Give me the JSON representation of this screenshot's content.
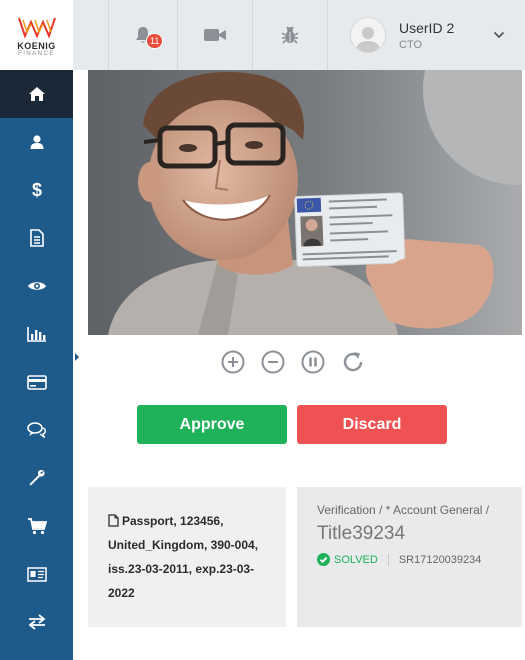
{
  "brand": {
    "name": "KOENIG",
    "sub": "FINANCE"
  },
  "sidebar": {
    "items": [
      {
        "icon": "home-icon",
        "active": true
      },
      {
        "icon": "user-icon"
      },
      {
        "icon": "dollar-icon"
      },
      {
        "icon": "document-icon"
      },
      {
        "icon": "eye-icon"
      },
      {
        "icon": "bar-chart-icon"
      },
      {
        "icon": "credit-card-icon"
      },
      {
        "icon": "chat-icon"
      },
      {
        "icon": "wrench-icon"
      },
      {
        "icon": "cart-icon"
      },
      {
        "icon": "id-card-icon"
      },
      {
        "icon": "exchange-icon"
      }
    ]
  },
  "header": {
    "notifications_count": "11",
    "user": {
      "name": "UserID 2",
      "role": "CTO"
    }
  },
  "actions": {
    "approve_label": "Approve",
    "discard_label": "Discard"
  },
  "document": {
    "text": "Passport, 123456, United_Kingdom, 390-004, iss.23-03-2011, exp.23-03-2022"
  },
  "ticket": {
    "breadcrumb": "Verification / * Account General /",
    "title": "Title39234",
    "status": "SOLVED",
    "reference": "SR17120039234"
  },
  "colors": {
    "sidebar": "#1e5a8a",
    "active": "#1b2838",
    "approve": "#1fb25a",
    "discard": "#ee5252"
  }
}
